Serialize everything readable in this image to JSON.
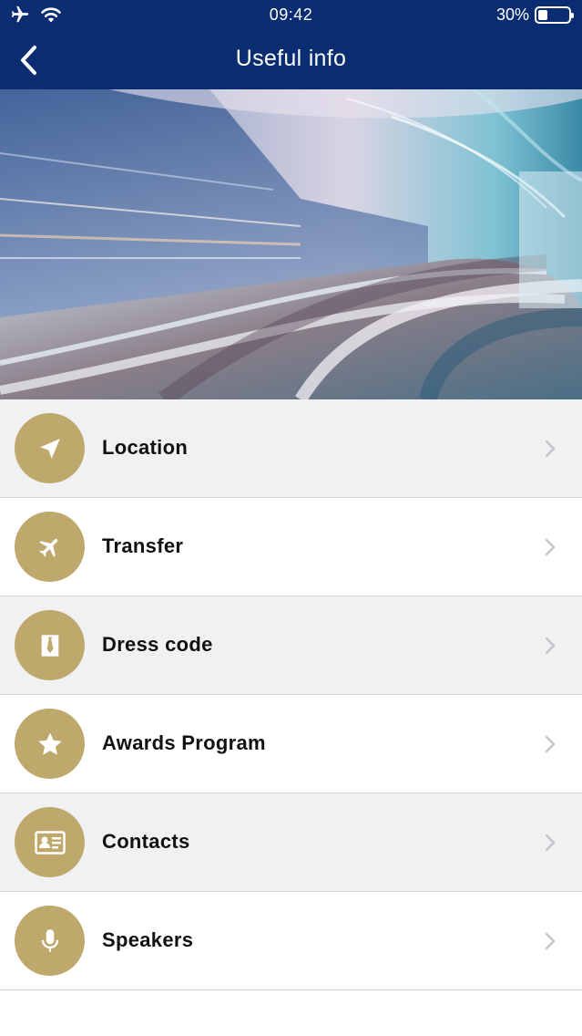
{
  "status_bar": {
    "time": "09:42",
    "battery_percent": "30%",
    "battery_level": 0.3,
    "icons": [
      "airplane-icon",
      "wifi-icon",
      "battery-icon"
    ]
  },
  "nav": {
    "title": "Useful info",
    "back_icon": "chevron-left-icon"
  },
  "hero": {
    "description_icon": "hero-image"
  },
  "colors": {
    "nav_background": "#0a2d72",
    "icon_circle": "#bfa86c",
    "row_shaded": "#f1f1f3",
    "row_plain": "#ffffff",
    "chevron": "#c4c4c8"
  },
  "menu": {
    "items": [
      {
        "label": "Location",
        "icon": "location-arrow-icon"
      },
      {
        "label": "Transfer",
        "icon": "airplane-icon"
      },
      {
        "label": "Dress code",
        "icon": "tie-icon"
      },
      {
        "label": "Awards Program",
        "icon": "star-icon"
      },
      {
        "label": "Contacts",
        "icon": "contact-card-icon"
      },
      {
        "label": "Speakers",
        "icon": "microphone-icon"
      }
    ]
  }
}
